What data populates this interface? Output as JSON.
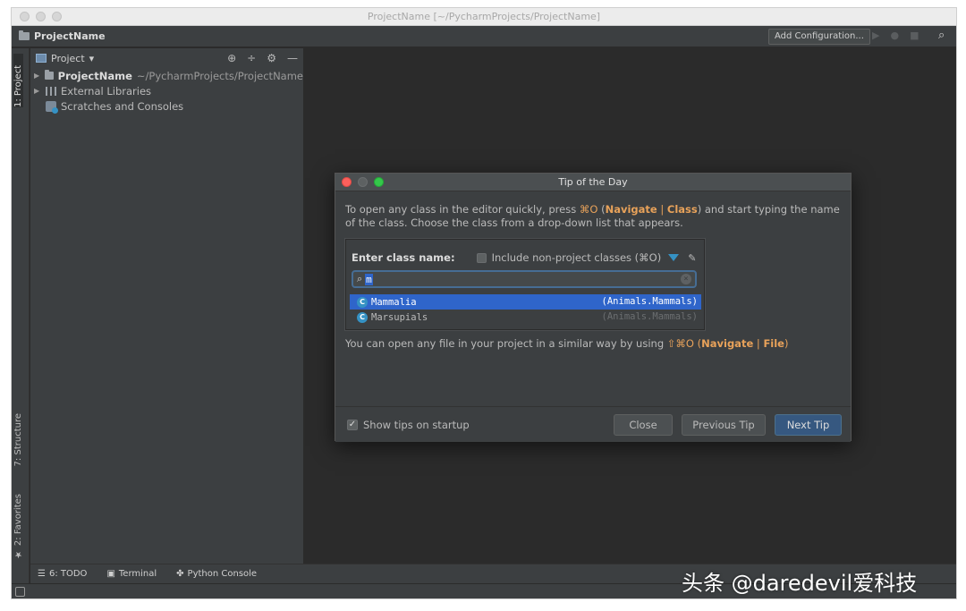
{
  "window": {
    "title": "ProjectName [~/PycharmProjects/ProjectName]"
  },
  "navbar": {
    "project_name": "ProjectName",
    "add_configuration": "Add Configuration...",
    "icons": [
      "run-icon",
      "debug-icon",
      "stop-icon",
      "search-icon"
    ]
  },
  "left_strip": {
    "project_tab": "1: Project",
    "structure_tab": "7: Structure",
    "favorites_tab": "2: Favorites"
  },
  "project_panel": {
    "title": "Project",
    "tree": [
      {
        "label": "ProjectName",
        "path": "~/PycharmProjects/ProjectName"
      },
      {
        "label": "External Libraries"
      },
      {
        "label": "Scratches and Consoles"
      }
    ]
  },
  "bottom_bar": {
    "todo": "6: TODO",
    "terminal": "Terminal",
    "python_console": "Python Console"
  },
  "dialog": {
    "title": "Tip of the Day",
    "tip_line1_a": "To open any class in the editor quickly, press ",
    "tip_shortcut": "⌘O",
    "tip_line1_b": " (",
    "tip_nav": "Navigate",
    "tip_sep": " | ",
    "tip_class": "Class",
    "tip_line1_c": ") and start typing the name of the class. Choose the class from a drop-down list that appears.",
    "demo": {
      "label": "Enter class name:",
      "checkbox_label": "Include non-project classes (⌘O)",
      "search_value": "m",
      "results": [
        {
          "name": "Mammalia",
          "package": "(Animals.Mammals)",
          "selected": true
        },
        {
          "name": "Marsupials",
          "package": "(Animals.Mammals)",
          "selected": false
        }
      ]
    },
    "tip2_a": "You can open any file in your project in a similar way by using ",
    "tip2_shortcut": "⇧⌘O",
    "tip2_b": " (",
    "tip2_nav": "Navigate",
    "tip2_sep": " | ",
    "tip2_file": "File",
    "tip2_c": ")",
    "show_tips_label": "Show tips on startup",
    "show_tips_checked": true,
    "close_button": "Close",
    "previous_button": "Previous Tip",
    "next_button": "Next Tip"
  },
  "watermark": "头条 @daredevil爱科技",
  "colors": {
    "editor_bg": "#2b2b2b",
    "panel_bg": "#3c3f41",
    "accent_blue": "#2f65ca",
    "highlight_orange": "#e8a25a",
    "default_button": "#365880"
  }
}
